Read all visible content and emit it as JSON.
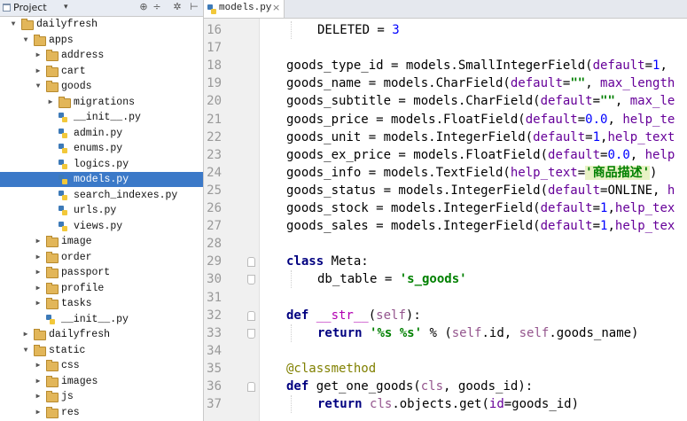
{
  "project_panel": {
    "title": "Project",
    "toolbar_icons": [
      "settings-icon",
      "collapse-icon",
      "gear-icon",
      "hide-icon"
    ],
    "tree": [
      {
        "label": "dailyfresh",
        "depth": 0,
        "type": "folder",
        "expanded": true
      },
      {
        "label": "apps",
        "depth": 1,
        "type": "folder",
        "expanded": true
      },
      {
        "label": "address",
        "depth": 2,
        "type": "folder",
        "expanded": false
      },
      {
        "label": "cart",
        "depth": 2,
        "type": "folder",
        "expanded": false
      },
      {
        "label": "goods",
        "depth": 2,
        "type": "folder",
        "expanded": true
      },
      {
        "label": "migrations",
        "depth": 3,
        "type": "folder",
        "expanded": false
      },
      {
        "label": "__init__.py",
        "depth": 3,
        "type": "py"
      },
      {
        "label": "admin.py",
        "depth": 3,
        "type": "py"
      },
      {
        "label": "enums.py",
        "depth": 3,
        "type": "py"
      },
      {
        "label": "logics.py",
        "depth": 3,
        "type": "py"
      },
      {
        "label": "models.py",
        "depth": 3,
        "type": "py",
        "selected": true
      },
      {
        "label": "search_indexes.py",
        "depth": 3,
        "type": "py"
      },
      {
        "label": "urls.py",
        "depth": 3,
        "type": "py"
      },
      {
        "label": "views.py",
        "depth": 3,
        "type": "py"
      },
      {
        "label": "image",
        "depth": 2,
        "type": "folder",
        "expanded": false
      },
      {
        "label": "order",
        "depth": 2,
        "type": "folder",
        "expanded": false
      },
      {
        "label": "passport",
        "depth": 2,
        "type": "folder",
        "expanded": false
      },
      {
        "label": "profile",
        "depth": 2,
        "type": "folder",
        "expanded": false
      },
      {
        "label": "tasks",
        "depth": 2,
        "type": "folder",
        "expanded": false
      },
      {
        "label": "__init__.py",
        "depth": 2,
        "type": "py"
      },
      {
        "label": "dailyfresh",
        "depth": 1,
        "type": "folder",
        "expanded": false
      },
      {
        "label": "static",
        "depth": 1,
        "type": "folder",
        "expanded": true
      },
      {
        "label": "css",
        "depth": 2,
        "type": "folder",
        "expanded": false
      },
      {
        "label": "images",
        "depth": 2,
        "type": "folder",
        "expanded": false
      },
      {
        "label": "js",
        "depth": 2,
        "type": "folder",
        "expanded": false
      },
      {
        "label": "res",
        "depth": 2,
        "type": "folder",
        "expanded": false
      }
    ]
  },
  "editor": {
    "tab_label": "models.py",
    "tab_close": "×",
    "lines": [
      {
        "n": "16",
        "indent": 1,
        "tokens": [
          [
            "t",
            "DELETED = "
          ],
          [
            "num",
            "3"
          ]
        ]
      },
      {
        "n": "17",
        "indent": 0,
        "tokens": []
      },
      {
        "n": "18",
        "indent": 0,
        "tokens": [
          [
            "t",
            "goods_type_id = models.SmallIntegerField("
          ],
          [
            "kwarg",
            "default"
          ],
          [
            "t",
            "="
          ],
          [
            "num",
            "1"
          ],
          [
            "t",
            ", "
          ]
        ]
      },
      {
        "n": "19",
        "indent": 0,
        "tokens": [
          [
            "t",
            "goods_name = models.CharField("
          ],
          [
            "kwarg",
            "default"
          ],
          [
            "t",
            "="
          ],
          [
            "str",
            "\"\""
          ],
          [
            "t",
            ", "
          ],
          [
            "kwarg",
            "max_length"
          ]
        ]
      },
      {
        "n": "20",
        "indent": 0,
        "tokens": [
          [
            "t",
            "goods_subtitle = models.CharField("
          ],
          [
            "kwarg",
            "default"
          ],
          [
            "t",
            "="
          ],
          [
            "str",
            "\"\""
          ],
          [
            "t",
            ", "
          ],
          [
            "kwarg",
            "max_le"
          ]
        ]
      },
      {
        "n": "21",
        "indent": 0,
        "tokens": [
          [
            "t",
            "goods_price = models.FloatField("
          ],
          [
            "kwarg",
            "default"
          ],
          [
            "t",
            "="
          ],
          [
            "num",
            "0.0"
          ],
          [
            "t",
            ", "
          ],
          [
            "kwarg",
            "help_te"
          ]
        ]
      },
      {
        "n": "22",
        "indent": 0,
        "tokens": [
          [
            "t",
            "goods_unit = models.IntegerField("
          ],
          [
            "kwarg",
            "default"
          ],
          [
            "t",
            "="
          ],
          [
            "num",
            "1"
          ],
          [
            "t",
            ","
          ],
          [
            "kwarg",
            "help_text"
          ]
        ]
      },
      {
        "n": "23",
        "indent": 0,
        "tokens": [
          [
            "t",
            "goods_ex_price = models.FloatField("
          ],
          [
            "kwarg",
            "default"
          ],
          [
            "t",
            "="
          ],
          [
            "num",
            "0.0"
          ],
          [
            "t",
            ", "
          ],
          [
            "kwarg",
            "help"
          ]
        ]
      },
      {
        "n": "24",
        "indent": 0,
        "tokens": [
          [
            "t",
            "goods_info = models.TextField("
          ],
          [
            "kwarg",
            "help_text"
          ],
          [
            "t",
            "="
          ],
          [
            "str2",
            "'商品描述'"
          ],
          [
            "t",
            ")"
          ]
        ]
      },
      {
        "n": "25",
        "indent": 0,
        "tokens": [
          [
            "t",
            "goods_status = models.IntegerField("
          ],
          [
            "kwarg",
            "default"
          ],
          [
            "t",
            "=ONLINE, "
          ],
          [
            "kwarg",
            "h"
          ]
        ]
      },
      {
        "n": "26",
        "indent": 0,
        "tokens": [
          [
            "t",
            "goods_stock = models.IntegerField("
          ],
          [
            "kwarg",
            "default"
          ],
          [
            "t",
            "="
          ],
          [
            "num",
            "1"
          ],
          [
            "t",
            ","
          ],
          [
            "kwarg",
            "help_tex"
          ]
        ]
      },
      {
        "n": "27",
        "indent": 0,
        "tokens": [
          [
            "t",
            "goods_sales = models.IntegerField("
          ],
          [
            "kwarg",
            "default"
          ],
          [
            "t",
            "="
          ],
          [
            "num",
            "1"
          ],
          [
            "t",
            ","
          ],
          [
            "kwarg",
            "help_tex"
          ]
        ]
      },
      {
        "n": "28",
        "indent": 0,
        "tokens": []
      },
      {
        "n": "29",
        "indent": 0,
        "tokens": [
          [
            "kw",
            "class "
          ],
          [
            "t",
            "Meta:"
          ]
        ],
        "fold": "up"
      },
      {
        "n": "30",
        "indent": 1,
        "tokens": [
          [
            "t",
            "db_table = "
          ],
          [
            "str",
            "'s_goods'"
          ]
        ],
        "fold": "down"
      },
      {
        "n": "31",
        "indent": 0,
        "tokens": []
      },
      {
        "n": "32",
        "indent": 0,
        "tokens": [
          [
            "kw",
            "def "
          ],
          [
            "mag",
            "__str__"
          ],
          [
            "t",
            "("
          ],
          [
            "self",
            "self"
          ],
          [
            "t",
            "):"
          ]
        ],
        "fold": "up"
      },
      {
        "n": "33",
        "indent": 1,
        "tokens": [
          [
            "kw",
            "return "
          ],
          [
            "str",
            "'%s %s'"
          ],
          [
            "t",
            " % ("
          ],
          [
            "self",
            "self"
          ],
          [
            "t",
            ".id, "
          ],
          [
            "self",
            "self"
          ],
          [
            "t",
            ".goods_name)"
          ]
        ],
        "fold": "down"
      },
      {
        "n": "34",
        "indent": 0,
        "tokens": []
      },
      {
        "n": "35",
        "indent": 0,
        "tokens": [
          [
            "deco",
            "@classmethod"
          ]
        ]
      },
      {
        "n": "36",
        "indent": 0,
        "tokens": [
          [
            "kw",
            "def "
          ],
          [
            "t",
            "get_one_goods("
          ],
          [
            "self",
            "cls"
          ],
          [
            "t",
            ", goods_id):"
          ]
        ],
        "fold": "up"
      },
      {
        "n": "37",
        "indent": 1,
        "tokens": [
          [
            "kw",
            "return "
          ],
          [
            "self",
            "cls"
          ],
          [
            "t",
            ".objects.get("
          ],
          [
            "kwarg",
            "id"
          ],
          [
            "t",
            "=goods_id)"
          ]
        ]
      }
    ]
  }
}
